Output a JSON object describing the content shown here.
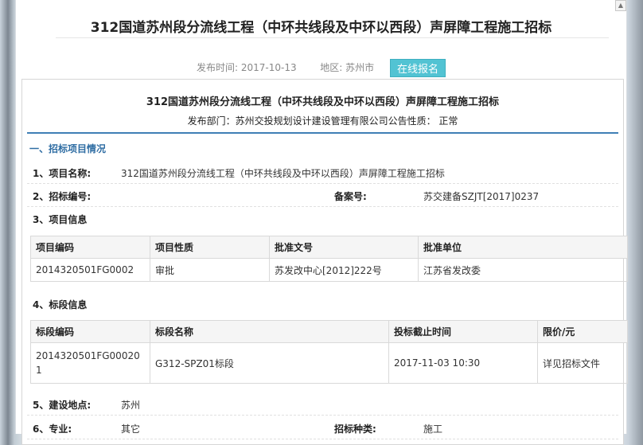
{
  "header": {
    "title": "312国道苏州段分流线工程（中环共线段及中环以西段）声屏障工程施工招标",
    "publish_label": "发布时间:",
    "publish_date": "2017-10-13",
    "region_label": "地区:",
    "region": "苏州市",
    "signup_button": "在线报名"
  },
  "notice": {
    "title": "312国道苏州段分流线工程（中环共线段及中环以西段）声屏障工程施工招标",
    "dept_line": "发布部门：苏州交投规划设计建设管理有限公司公告性质：  正常",
    "section1_title": "一、招标项目情况",
    "project_name_label": "1、项目名称:",
    "project_name": "312国道苏州段分流线工程（中环共线段及中环以西段）声屏障工程施工招标",
    "bid_no_label": "2、招标编号:",
    "record_no_label": "备案号:",
    "record_no": "苏交建备SZJT[2017]0237",
    "project_info_label": "3、项目信息",
    "project_table": {
      "headers": [
        "项目编码",
        "项目性质",
        "批准文号",
        "批准单位"
      ],
      "rows": [
        [
          "2014320501FG0002",
          "审批",
          "苏发改中心[2012]222号",
          "江苏省发改委"
        ]
      ]
    },
    "section_info_label": "4、标段信息",
    "section_table": {
      "headers": [
        "标段编码",
        "标段名称",
        "投标截止时间",
        "限价/元"
      ],
      "rows": [
        [
          "2014320501FG000201",
          "G312-SPZ01标段",
          "2017-11-03 10:30",
          "详见招标文件"
        ]
      ]
    },
    "location_label": "5、建设地点:",
    "location": "苏州",
    "major_label": "6、专业:",
    "major": "其它",
    "bid_type_label": "招标种类:",
    "bid_type": "施工"
  }
}
